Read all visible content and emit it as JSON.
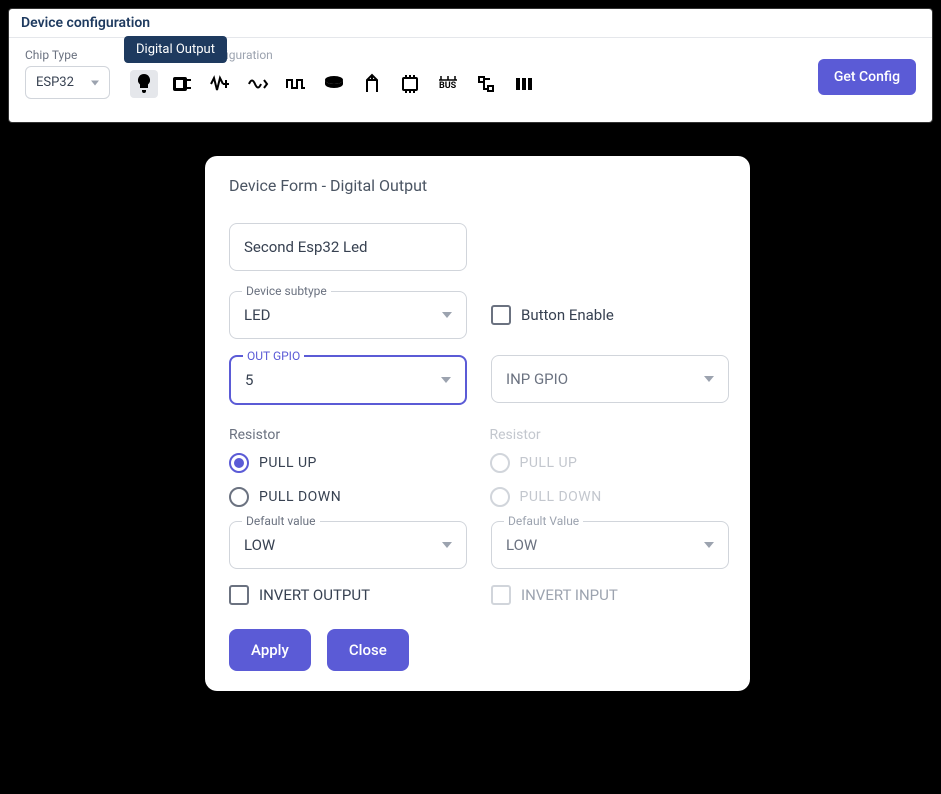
{
  "header": {
    "title": "Device configuration",
    "chip_type_label": "Chip Type",
    "chip_type_value": "ESP32",
    "tooltip": "Digital Output",
    "select_label": "Select a New configuration",
    "get_config_label": "Get Config",
    "icon_names": [
      "bulb-icon",
      "relay-icon",
      "analog-in-icon",
      "analog-out-icon",
      "pulse-icon",
      "digital-in-icon",
      "potentiometer-icon",
      "controller-icon",
      "bus-icon",
      "switch-icon",
      "group-icon"
    ]
  },
  "form": {
    "title": "Device Form - Digital Output",
    "device_name": "Second Esp32 Led",
    "subtype_label": "Device subtype",
    "subtype_value": "LED",
    "button_enable_label": "Button Enable",
    "out_gpio_label": "OUT GPIO",
    "out_gpio_value": "5",
    "inp_gpio_placeholder": "INP GPIO",
    "resistor_label": "Resistor",
    "pull_up_label": "PULL UP",
    "pull_down_label": "PULL DOWN",
    "default_value_label_out": "Default value",
    "default_value_label_in": "Default Value",
    "default_value_out": "LOW",
    "default_value_in": "LOW",
    "invert_output_label": "INVERT OUTPUT",
    "invert_input_label": "INVERT INPUT",
    "apply_label": "Apply",
    "close_label": "Close"
  }
}
